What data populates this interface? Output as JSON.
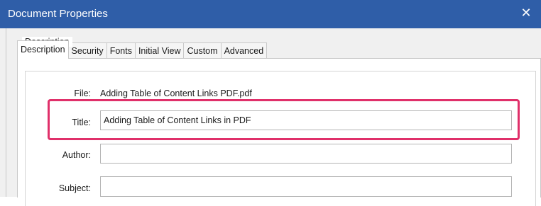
{
  "window": {
    "title": "Document Properties",
    "close_glyph": "✕"
  },
  "tabs": [
    {
      "label": "Description",
      "active": true
    },
    {
      "label": "Security"
    },
    {
      "label": "Fonts"
    },
    {
      "label": "Initial View"
    },
    {
      "label": "Custom"
    },
    {
      "label": "Advanced"
    }
  ],
  "description": {
    "group_label": "Description",
    "file_label": "File:",
    "file_value": "Adding Table of Content Links PDF.pdf",
    "title_label": "Title:",
    "title_value": "Adding Table of Content Links in PDF",
    "author_label": "Author:",
    "author_value": "",
    "subject_label": "Subject:",
    "subject_value": ""
  },
  "colors": {
    "titlebar": "#2f5ea8",
    "highlight": "#e0306a"
  }
}
